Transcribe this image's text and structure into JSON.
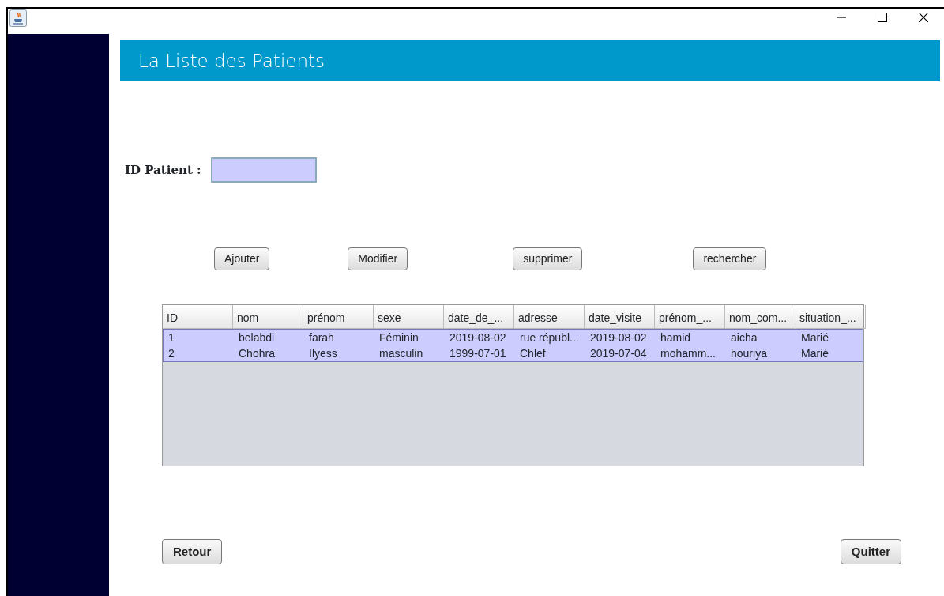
{
  "header": {
    "title": "La Liste des Patients"
  },
  "search": {
    "label": "ID Patient :"
  },
  "actions": [
    "Ajouter",
    "Modifier",
    "supprimer",
    "rechercher"
  ],
  "table": {
    "columns": [
      "ID",
      "nom",
      "prénom",
      "sexe",
      "date_de_...",
      "adresse",
      "date_visite",
      "prénom_...",
      "nom_com...",
      "situation_..."
    ],
    "rows": [
      {
        "selected": true,
        "cells": [
          "1",
          "belabdi",
          "farah",
          "Féminin",
          "2019-08-02",
          "rue républ...",
          "2019-08-02",
          "hamid",
          "aicha",
          "Marié"
        ]
      },
      {
        "selected": true,
        "cells": [
          "2",
          "Chohra",
          "Ilyess",
          "masculin",
          "1999-07-01",
          "Chlef",
          "2019-07-04",
          "mohamm...",
          "houriya",
          "Marié"
        ]
      }
    ]
  },
  "footer_buttons": [
    "Retour",
    "Quitter"
  ]
}
